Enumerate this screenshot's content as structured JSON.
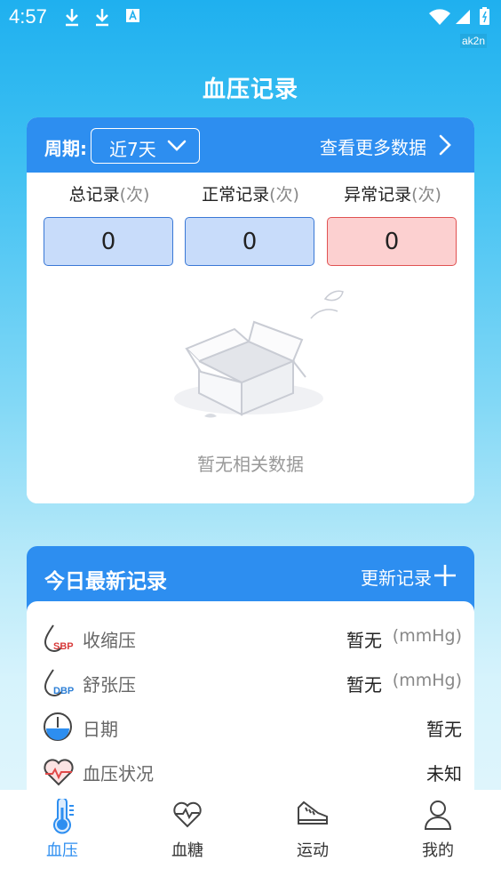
{
  "status": {
    "time": "4:57",
    "badge": "ak2n"
  },
  "page": {
    "title": "血压记录"
  },
  "summary": {
    "period_label": "周期:",
    "period_value": "近7天",
    "more_link": "查看更多数据",
    "stats": [
      {
        "label": "总记录",
        "unit": "(次)",
        "value": "0"
      },
      {
        "label": "正常记录",
        "unit": "(次)",
        "value": "0"
      },
      {
        "label": "异常记录",
        "unit": "(次)",
        "value": "0"
      }
    ],
    "empty_text": "暂无相关数据"
  },
  "latest": {
    "title": "今日最新记录",
    "update_label": "更新记录",
    "rows": [
      {
        "icon": "sbp-drop-icon",
        "label": "收缩压",
        "value": "暂无",
        "unit": "(mmHg)"
      },
      {
        "icon": "dbp-drop-icon",
        "label": "舒张压",
        "value": "暂无",
        "unit": "(mmHg)"
      },
      {
        "icon": "clock-icon",
        "label": "日期",
        "value": "暂无"
      },
      {
        "icon": "heart-pulse-icon",
        "label": "血压状况",
        "value": "未知"
      }
    ],
    "icon_labels": {
      "sbp": "SBP",
      "dbp": "DBP"
    }
  },
  "tabs": [
    {
      "label": "血压",
      "icon": "thermometer-icon",
      "active": true
    },
    {
      "label": "血糖",
      "icon": "heart-wave-icon",
      "active": false
    },
    {
      "label": "运动",
      "icon": "shoe-icon",
      "active": false
    },
    {
      "label": "我的",
      "icon": "person-icon",
      "active": false
    }
  ],
  "colors": {
    "primary": "#2d8ef0",
    "abnormal_bg": "#fcd0d0",
    "normal_bg": "#c8dcfa"
  }
}
